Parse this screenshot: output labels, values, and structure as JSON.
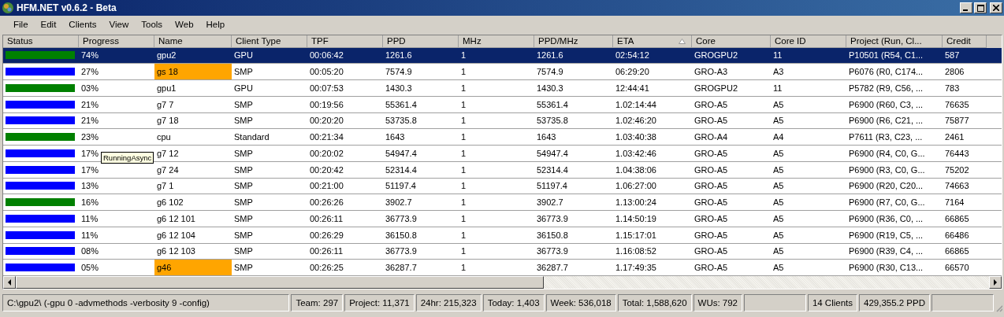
{
  "window": {
    "title": "HFM.NET v0.6.2 - Beta"
  },
  "menu": [
    "File",
    "Edit",
    "Clients",
    "View",
    "Tools",
    "Web",
    "Help"
  ],
  "table": {
    "columns": [
      {
        "label": "Status"
      },
      {
        "label": "Progress"
      },
      {
        "label": "Name"
      },
      {
        "label": "Client Type"
      },
      {
        "label": "TPF"
      },
      {
        "label": "PPD"
      },
      {
        "label": "MHz"
      },
      {
        "label": "PPD/MHz"
      },
      {
        "label": "ETA",
        "sorted": true
      },
      {
        "label": "Core"
      },
      {
        "label": "Core ID"
      },
      {
        "label": "Project (Run, Cl..."
      },
      {
        "label": "Credit"
      }
    ],
    "rows": [
      {
        "selected": true,
        "color": "#008000",
        "name_highlight": false,
        "cells": [
          "",
          "74%",
          "gpu2",
          "GPU",
          "00:06:42",
          "1261.6",
          "1",
          "1261.6",
          "02:54:12",
          "GROGPU2",
          "11",
          "P10501 (R54, C1...",
          "587"
        ]
      },
      {
        "selected": false,
        "color": "#0000ff",
        "name_highlight": true,
        "cells": [
          "",
          "27%",
          "gs 18",
          "SMP",
          "00:05:20",
          "7574.9",
          "1",
          "7574.9",
          "06:29:20",
          "GRO-A3",
          "A3",
          "P6076 (R0, C174...",
          "2806"
        ]
      },
      {
        "selected": false,
        "color": "#008000",
        "name_highlight": false,
        "cells": [
          "",
          "03%",
          "gpu1",
          "GPU",
          "00:07:53",
          "1430.3",
          "1",
          "1430.3",
          "12:44:41",
          "GROGPU2",
          "11",
          "P5782 (R9, C56, ...",
          "783"
        ]
      },
      {
        "selected": false,
        "color": "#0000ff",
        "name_highlight": false,
        "cells": [
          "",
          "21%",
          "g7 7",
          "SMP",
          "00:19:56",
          "55361.4",
          "1",
          "55361.4",
          "1.02:14:44",
          "GRO-A5",
          "A5",
          "P6900 (R60, C3, ...",
          "76635"
        ]
      },
      {
        "selected": false,
        "color": "#0000ff",
        "name_highlight": false,
        "cells": [
          "",
          "21%",
          "g7 18",
          "SMP",
          "00:20:20",
          "53735.8",
          "1",
          "53735.8",
          "1.02:46:20",
          "GRO-A5",
          "A5",
          "P6900 (R6, C21, ...",
          "75877"
        ]
      },
      {
        "selected": false,
        "color": "#008000",
        "name_highlight": false,
        "cells": [
          "",
          "23%",
          "cpu",
          "Standard",
          "00:21:34",
          "1643",
          "1",
          "1643",
          "1.03:40:38",
          "GRO-A4",
          "A4",
          "P7611 (R3, C23, ...",
          "2461"
        ]
      },
      {
        "selected": false,
        "color": "#0000ff",
        "name_highlight": false,
        "cells": [
          "",
          "17%",
          "g7 12",
          "SMP",
          "00:20:02",
          "54947.4",
          "1",
          "54947.4",
          "1.03:42:46",
          "GRO-A5",
          "A5",
          "P6900 (R4, C0, G...",
          "76443"
        ]
      },
      {
        "selected": false,
        "color": "#0000ff",
        "name_highlight": false,
        "cells": [
          "",
          "17%",
          "g7 24",
          "SMP",
          "00:20:42",
          "52314.4",
          "1",
          "52314.4",
          "1.04:38:06",
          "GRO-A5",
          "A5",
          "P6900 (R3, C0, G...",
          "75202"
        ]
      },
      {
        "selected": false,
        "color": "#0000ff",
        "name_highlight": false,
        "cells": [
          "",
          "13%",
          "g7 1",
          "SMP",
          "00:21:00",
          "51197.4",
          "1",
          "51197.4",
          "1.06:27:00",
          "GRO-A5",
          "A5",
          "P6900 (R20, C20...",
          "74663"
        ]
      },
      {
        "selected": false,
        "color": "#008000",
        "name_highlight": false,
        "cells": [
          "",
          "16%",
          "g6 102",
          "SMP",
          "00:26:26",
          "3902.7",
          "1",
          "3902.7",
          "1.13:00:24",
          "GRO-A5",
          "A5",
          "P6900 (R7, C0, G...",
          "7164"
        ]
      },
      {
        "selected": false,
        "color": "#0000ff",
        "name_highlight": false,
        "cells": [
          "",
          "11%",
          "g6 12 101",
          "SMP",
          "00:26:11",
          "36773.9",
          "1",
          "36773.9",
          "1.14:50:19",
          "GRO-A5",
          "A5",
          "P6900 (R36, C0, ...",
          "66865"
        ]
      },
      {
        "selected": false,
        "color": "#0000ff",
        "name_highlight": false,
        "cells": [
          "",
          "11%",
          "g6 12 104",
          "SMP",
          "00:26:29",
          "36150.8",
          "1",
          "36150.8",
          "1.15:17:01",
          "GRO-A5",
          "A5",
          "P6900 (R19, C5, ...",
          "66486"
        ]
      },
      {
        "selected": false,
        "color": "#0000ff",
        "name_highlight": false,
        "cells": [
          "",
          "08%",
          "g6 12 103",
          "SMP",
          "00:26:11",
          "36773.9",
          "1",
          "36773.9",
          "1.16:08:52",
          "GRO-A5",
          "A5",
          "P6900 (R39, C4, ...",
          "66865"
        ]
      },
      {
        "selected": false,
        "color": "#0000ff",
        "name_highlight": true,
        "cells": [
          "",
          "05%",
          "g46",
          "SMP",
          "00:26:25",
          "36287.7",
          "1",
          "36287.7",
          "1.17:49:35",
          "GRO-A5",
          "A5",
          "P6900 (R30, C13...",
          "66570"
        ]
      }
    ]
  },
  "tooltip": "RunningAsync",
  "status_bar": [
    "C:\\gpu2\\ (-gpu 0 -advmethods -verbosity 9 -config)",
    "Team: 297",
    "Project: 11,371",
    "24hr: 215,323",
    "Today: 1,403",
    "Week: 536,018",
    "Total: 1,588,620",
    "WUs: 792",
    "14 Clients",
    "429,355.2 PPD"
  ]
}
